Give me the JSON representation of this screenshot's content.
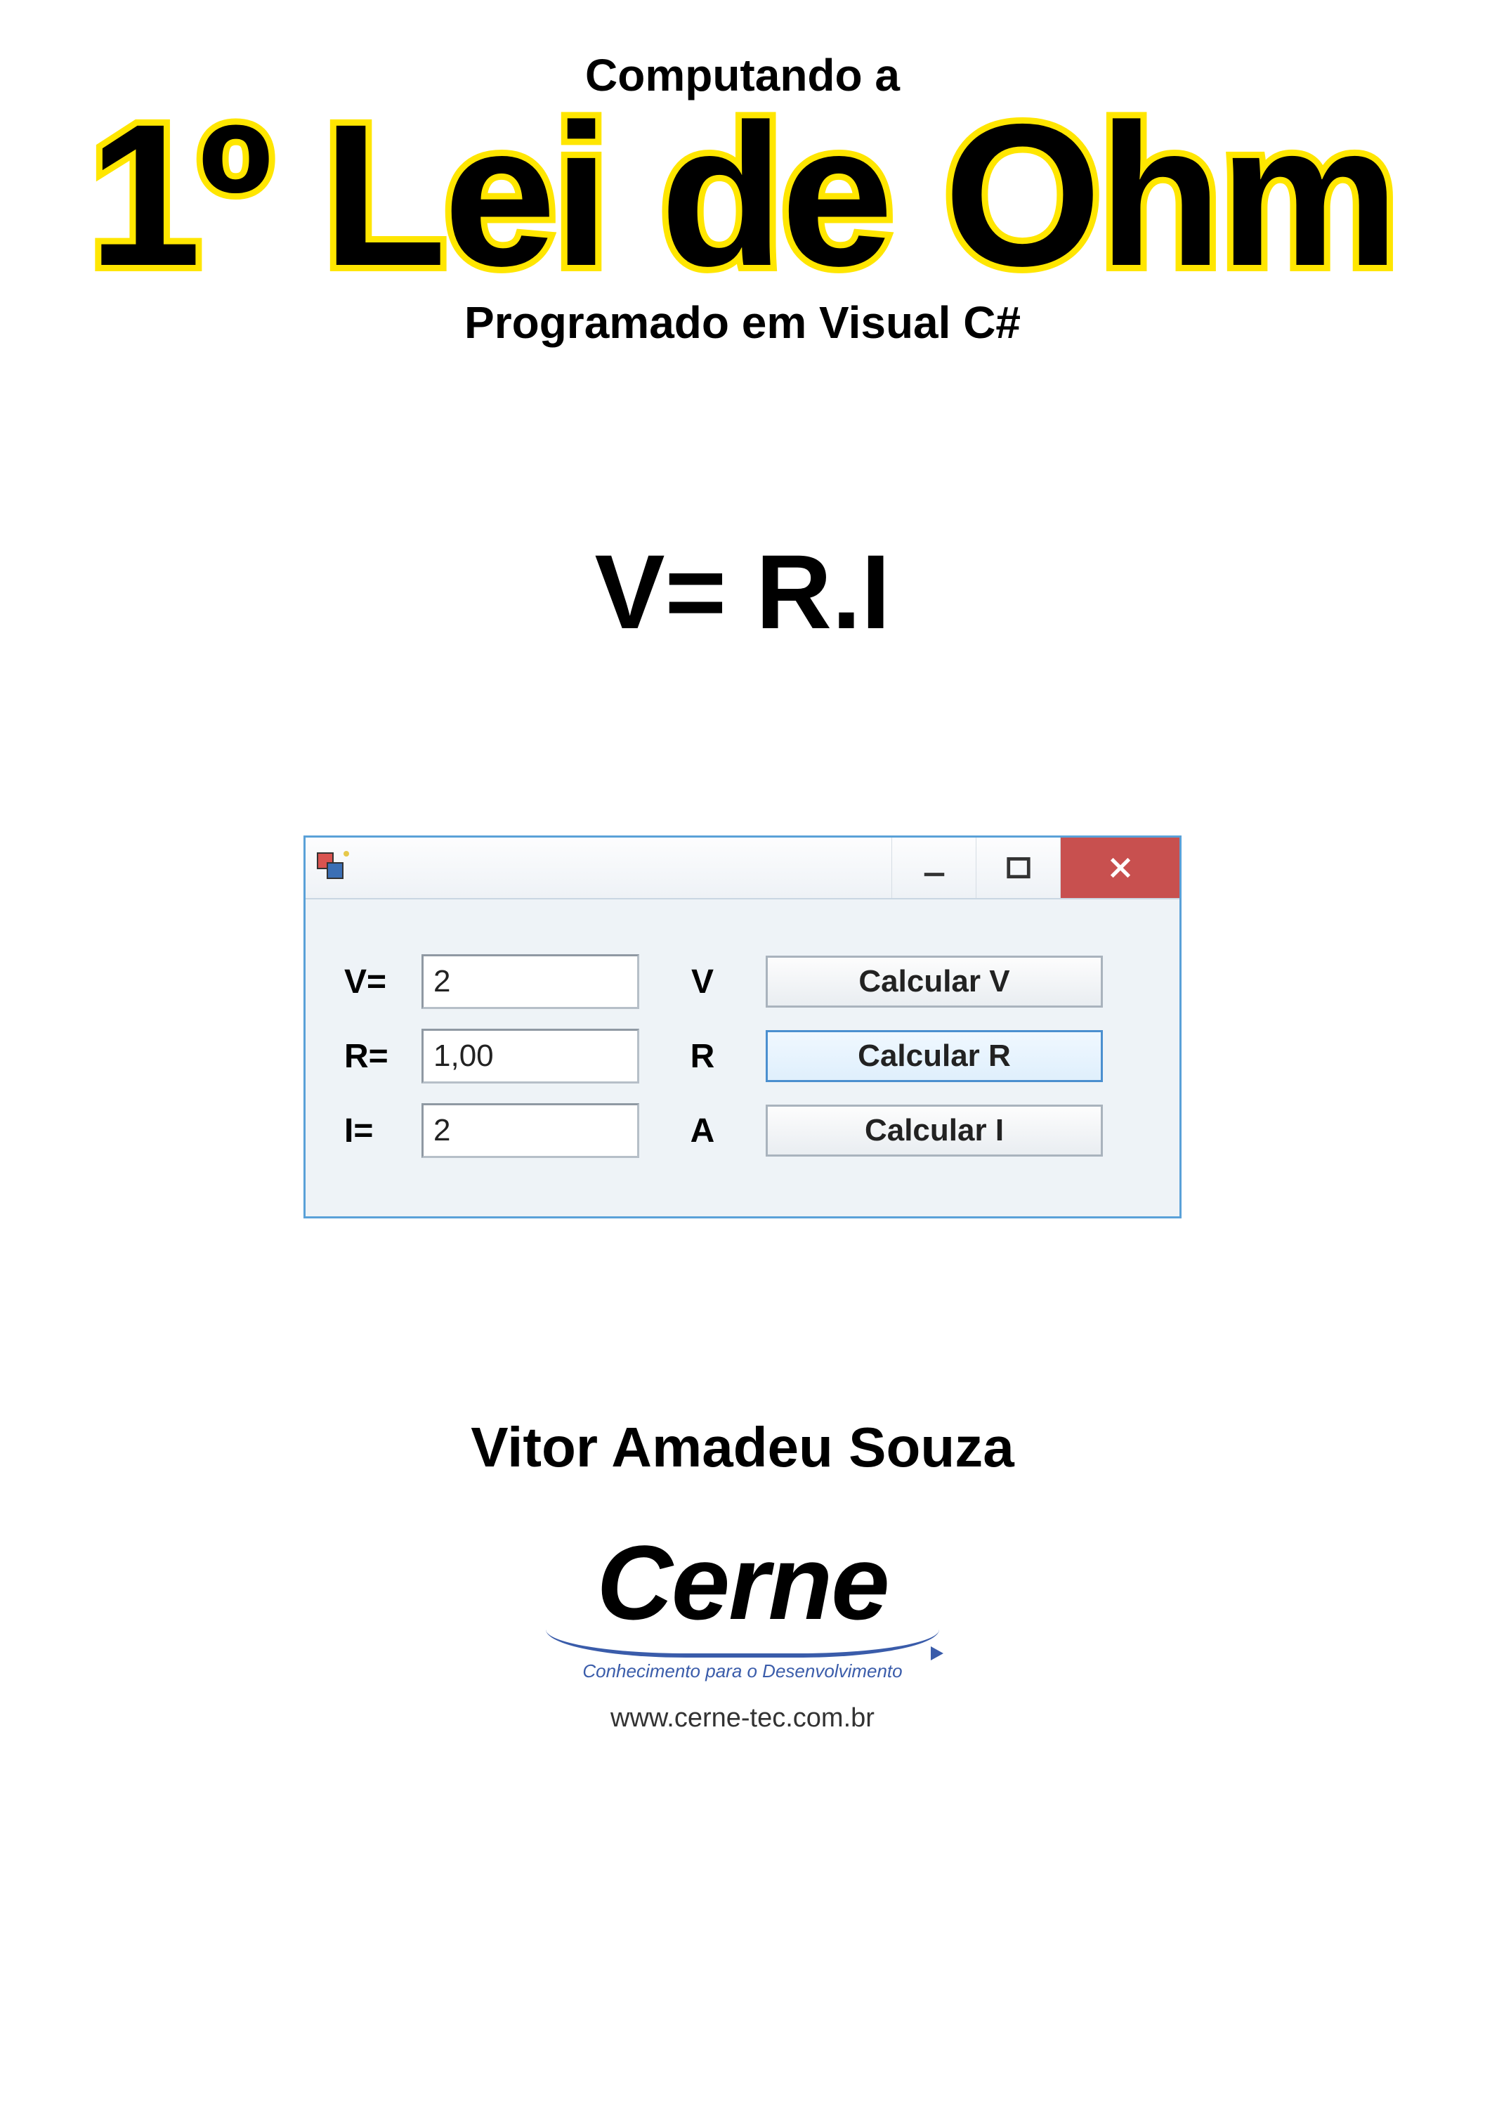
{
  "header": {
    "pretitle": "Computando a",
    "title": "1º Lei de Ohm",
    "subtitle": "Programado em Visual C#"
  },
  "formula": "V= R.I",
  "window": {
    "rows": [
      {
        "label": "V=",
        "value": "2",
        "unit": "V",
        "button": "Calcular V",
        "active": false
      },
      {
        "label": "R=",
        "value": "1,00",
        "unit": "R",
        "button": "Calcular R",
        "active": true
      },
      {
        "label": "I=",
        "value": "2",
        "unit": "A",
        "button": "Calcular I",
        "active": false
      }
    ]
  },
  "author": "Vitor Amadeu Souza",
  "brand": {
    "name": "Cerne",
    "tagline": "Conhecimento para o Desenvolvimento",
    "website": "www.cerne-tec.com.br"
  }
}
